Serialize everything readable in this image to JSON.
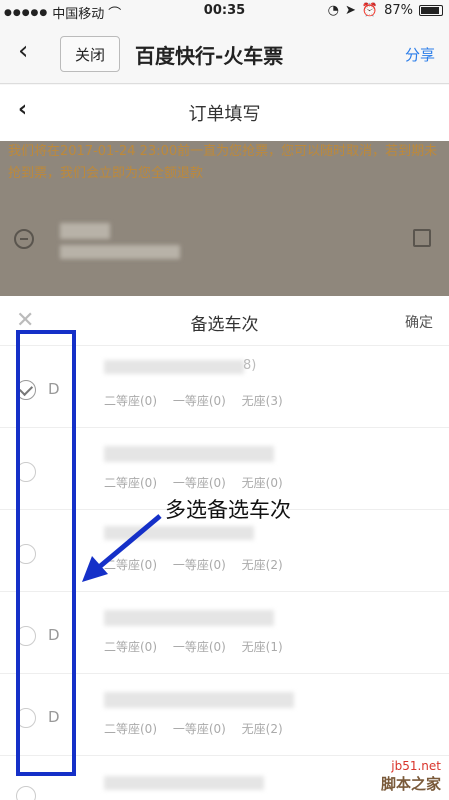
{
  "status_bar": {
    "carrier": "中国移动",
    "time": "00:35",
    "battery": "87%"
  },
  "top_nav": {
    "close_label": "关闭",
    "title": "百度快行-火车票",
    "share_label": "分享"
  },
  "order_header": {
    "title": "订单填写"
  },
  "notice": {
    "text": "我们将在2017-01-24 23:00前一直为您抢票，您可以随时取消，若到期未抢到票，我们会立即为您全额退款"
  },
  "sheet": {
    "title": "备选车次",
    "confirm_label": "确定",
    "trains": [
      {
        "code": "D",
        "suffix": "8)",
        "selected": true,
        "seats": [
          "二等座(0)",
          "一等座(0)",
          "无座(3)"
        ]
      },
      {
        "code": "",
        "suffix": "",
        "selected": false,
        "seats": [
          "二等座(0)",
          "一等座(0)",
          "无座(0)"
        ]
      },
      {
        "code": "",
        "suffix": "",
        "selected": false,
        "seats": [
          "二等座(0)",
          "一等座(0)",
          "无座(2)"
        ]
      },
      {
        "code": "D",
        "suffix": "",
        "selected": false,
        "seats": [
          "二等座(0)",
          "一等座(0)",
          "无座(1)"
        ]
      },
      {
        "code": "D",
        "suffix": "",
        "selected": false,
        "seats": [
          "二等座(0)",
          "一等座(0)",
          "无座(2)"
        ]
      }
    ]
  },
  "annotation": {
    "text": "多选备选车次",
    "color": "#1530c8"
  },
  "watermark": {
    "site": "jb51.net",
    "name": "脚本之家"
  }
}
